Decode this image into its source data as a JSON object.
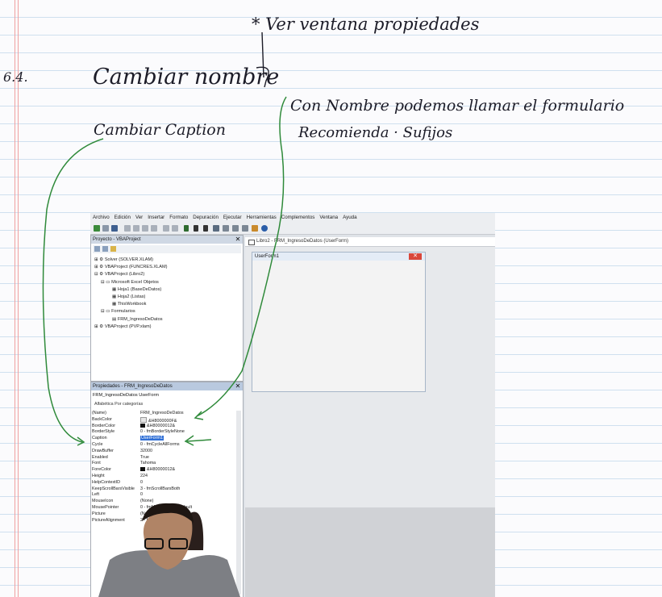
{
  "notes": {
    "page_number": "6.4.",
    "note_rename": "Cambiar nombre",
    "note_properties": "* Ver ventana propiedades",
    "note_caption": "Cambiar Caption",
    "note_name_use": "Con Nombre podemos llamar el formulario",
    "note_suffix": "Recomienda · Sufijos"
  },
  "colors": {
    "ink": "#1c1c28",
    "arrow": "#2f8a3a",
    "selection": "#2f6fd6"
  },
  "editor": {
    "menu": [
      "Archivo",
      "Edición",
      "Ver",
      "Insertar",
      "Formato",
      "Depuración",
      "Ejecutar",
      "Herramientas",
      "Complementos",
      "Ventana",
      "Ayuda"
    ],
    "project_panel": {
      "title": "Proyecto - VBAProject",
      "items": [
        "Solver (SOLVER.XLAM)",
        "VBAProject (FUNCRES.XLAM)",
        "VBAProject (Libro2)",
        "Microsoft Excel Objetos",
        "Hoja1 (BaseDeDatos)",
        "Hoja2 (Listas)",
        "ThisWorkbook",
        "Formularios",
        "FRM_IngresoDeDatos",
        "VBAProject (PVP.xlam)"
      ]
    },
    "properties_panel": {
      "title": "Propiedades - FRM_IngresoDeDatos",
      "object": "FRM_IngresoDeDatos UserForm",
      "tabs": "Alfabética  Por categorías",
      "rows": [
        {
          "name": "(Name)",
          "value": "FRM_IngresoDeDatos"
        },
        {
          "name": "BackColor",
          "value": "&H8000000F&"
        },
        {
          "name": "BorderColor",
          "value": "&H80000012&"
        },
        {
          "name": "BorderStyle",
          "value": "0 - fmBorderStyleNone"
        },
        {
          "name": "Caption",
          "value": "UserForm1"
        },
        {
          "name": "Cycle",
          "value": "0 - fmCycleAllForms"
        },
        {
          "name": "DrawBuffer",
          "value": "32000"
        },
        {
          "name": "Enabled",
          "value": "True"
        },
        {
          "name": "Font",
          "value": "Tahoma"
        },
        {
          "name": "ForeColor",
          "value": "&H80000012&"
        },
        {
          "name": "Height",
          "value": "224"
        },
        {
          "name": "HelpContextID",
          "value": "0"
        },
        {
          "name": "KeepScrollBarsVisible",
          "value": "3 - fmScrollBarsBoth"
        },
        {
          "name": "Left",
          "value": "0"
        },
        {
          "name": "MouseIcon",
          "value": "(None)"
        },
        {
          "name": "MousePointer",
          "value": "0 - fmMousePointerDefault"
        },
        {
          "name": "Picture",
          "value": "(None)"
        },
        {
          "name": "PictureAlignment",
          "value": "2 - fmPictureAlignmentCenter"
        }
      ]
    },
    "designer": {
      "window_title": "Libro2 - FRM_IngresoDeDatos (UserForm)",
      "form_caption": "UserForm1"
    }
  }
}
